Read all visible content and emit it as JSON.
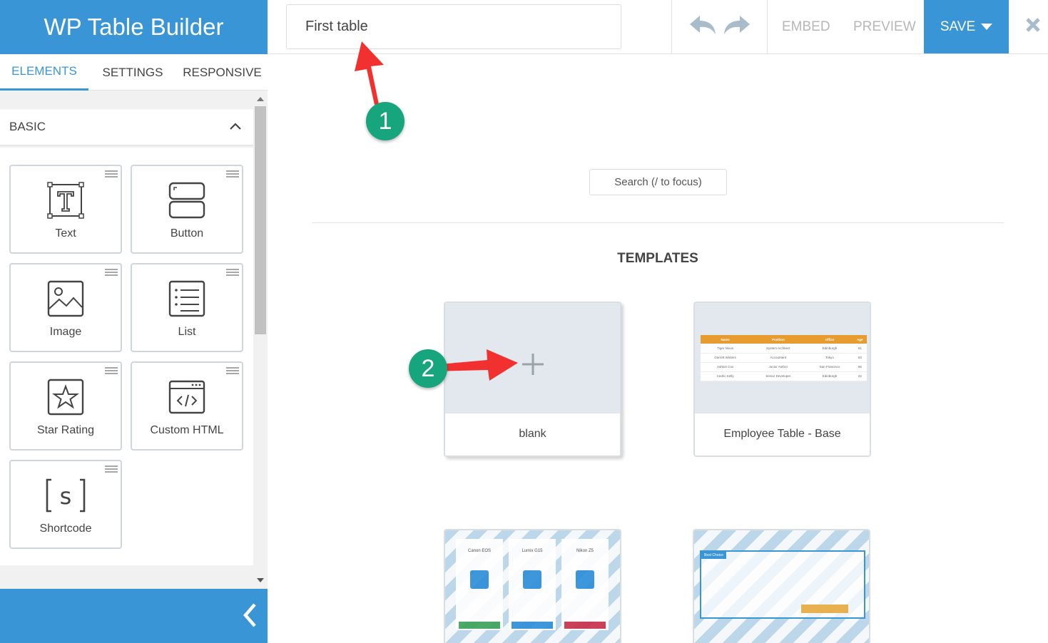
{
  "app": {
    "title": "WP Table Builder"
  },
  "sidebar": {
    "tabs": [
      {
        "label": "ELEMENTS",
        "active": true
      },
      {
        "label": "SETTINGS",
        "active": false
      },
      {
        "label": "RESPONSIVE",
        "active": false
      }
    ],
    "section": {
      "label": "BASIC",
      "expanded": true,
      "toggle_icon": "chevron-up-icon"
    },
    "elements": [
      {
        "label": "Text",
        "icon": "text-icon"
      },
      {
        "label": "Button",
        "icon": "button-icon"
      },
      {
        "label": "Image",
        "icon": "image-icon"
      },
      {
        "label": "List",
        "icon": "list-icon"
      },
      {
        "label": "Star Rating",
        "icon": "star-rating-icon"
      },
      {
        "label": "Custom HTML",
        "icon": "code-icon"
      },
      {
        "label": "Shortcode",
        "icon": "shortcode-icon"
      }
    ],
    "collapse_icon": "chevron-left-icon"
  },
  "toolbar": {
    "table_title_value": "First table",
    "undo_icon": "undo-icon",
    "redo_icon": "redo-icon",
    "embed_label": "EMBED",
    "preview_label": "PREVIEW",
    "save_label": "SAVE",
    "close_icon": "close-icon"
  },
  "main": {
    "search_placeholder": "Search (/ to focus)",
    "templates_heading": "TEMPLATES",
    "templates": [
      {
        "name": "blank"
      },
      {
        "name": "Employee Table - Base"
      },
      {
        "name": ""
      },
      {
        "name": ""
      }
    ],
    "employee_preview": {
      "headers": [
        "Name",
        "Position",
        "Office",
        "Age"
      ],
      "rows": [
        [
          "Tiger Nixon",
          "System Architect",
          "Edinburgh",
          "61"
        ],
        [
          "Garrett Winters",
          "Accountant",
          "Tokyo",
          "63"
        ],
        [
          "Ashton Cox",
          "Junior Author",
          "San Francisco",
          "66"
        ],
        [
          "Cedric Kelly",
          "Senior Developer",
          "Edinburgh",
          "22"
        ]
      ]
    },
    "pricing_preview": {
      "products": [
        "Canon EOS",
        "Lumix G15",
        "Nikon Z5"
      ],
      "button_colors": [
        "#3fa45a",
        "#2f8fd8",
        "#c8324a"
      ]
    },
    "affiliate_preview": {
      "badge": "Best Choice"
    }
  },
  "annotations": {
    "marker_1": "1",
    "marker_2": "2",
    "arrow_color": "#f0312f",
    "marker_color": "#17a57e"
  },
  "colors": {
    "brand": "#3a95d6"
  }
}
